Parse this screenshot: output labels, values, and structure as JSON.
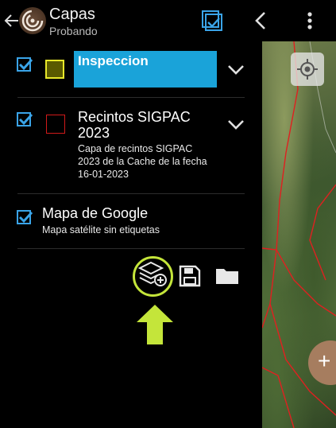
{
  "header": {
    "title": "Capas",
    "subtitle": "Probando",
    "icons": [
      "back-arrow-icon",
      "app-logo",
      "select-all-icon",
      "chevron-left-icon",
      "more-vert-icon"
    ]
  },
  "layers": [
    {
      "name": "Inspeccion",
      "checked": true,
      "swatch_border": "#e8e82a",
      "swatch_fill": "#5a5a00",
      "editing": true,
      "input_color": "#1aa3d9"
    },
    {
      "name": "Recintos SIGPAC 2023",
      "name_line1": "Recintos SIGPAC",
      "name_line2": "2023",
      "description": "Capa de recintos SIGPAC 2023 de la Cache de la fecha 16-01-2023",
      "desc_line1": "Capa de recintos SIGPAC",
      "desc_line2": "2023 de la Cache de la fecha",
      "desc_line3": "16-01-2023",
      "checked": true,
      "swatch_border": "#d11a1a"
    },
    {
      "name": "Mapa de Google",
      "description": "Mapa satélite sin etiquetas",
      "checked": true
    }
  ],
  "actions": {
    "icons": [
      "add-layer-icon",
      "save-icon",
      "folder-icon"
    ]
  },
  "accent_colors": {
    "checkbox": "#3aa4e8",
    "highlight": "#c4e53a",
    "fab": "#a67d5f"
  },
  "fab": {
    "label": "+"
  }
}
